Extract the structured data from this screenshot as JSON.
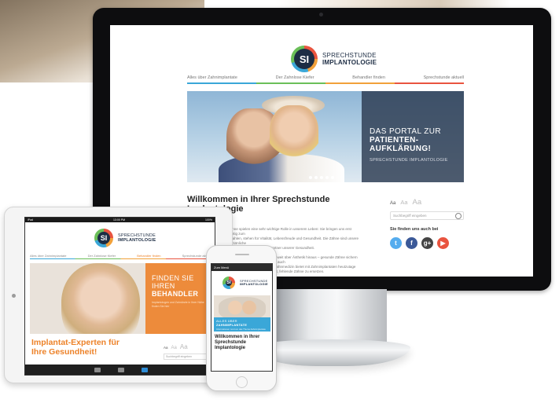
{
  "brand": {
    "mark": "SI",
    "line1": "SPRECHSTUNDE",
    "line2": "IMPLANTOLOGIE"
  },
  "colors": {
    "blue": "#3aa7d8",
    "green": "#6bbf59",
    "orange": "#ed8229",
    "red": "#e9543f",
    "navy": "#1d2d44"
  },
  "desktop": {
    "nav": [
      "Alles über Zahnimplantate",
      "Der Zahnlose Kiefer",
      "Behandler finden",
      "Sprechstunde aktuell"
    ],
    "hero": {
      "line1": "DAS PORTAL ZUR",
      "line2": "PATIENTEN-",
      "line3": "AUFKLÄRUNG!",
      "sub": "SPRECHSTUNDE IMPLANTOLOGIE"
    },
    "welcome": {
      "line1": "Willkommen in Ihrer Sprechstunde",
      "line2": "Implantologie"
    },
    "body": [
      "Zähne spielen eine sehr wichtige Rolle in unserem Leben: Sie bringen uns erst richtig zum",
      "Strahlen, stehen für Vitalität, Lebensfreude und Gesundheit. Die Zähne sind unsere persönliche",
      "Visitenkarte und ein fester Partner unserer Gesundheit.",
      "",
      "Doch die Zahngesundheit geht weit über Ästhetik hinaus – gesunde Zähne sichern nicht nur die Funktion, sondern auch",
      "Lebensqualität. Die moderne Zahnmedizin bietet mit Zahnimplantaten heutzutage",
      "eine hervorragende Möglichkeit, fehlende Zähne zu ersetzen."
    ],
    "sidebar": {
      "font_sizes": [
        "Aa",
        "Aa",
        "Aa"
      ],
      "search_placeholder": "Suchbegriff eingeben",
      "social_heading": "Sie finden uns auch bei",
      "social": [
        {
          "name": "twitter-icon",
          "glyph": "t",
          "color": "#55acee"
        },
        {
          "name": "facebook-icon",
          "glyph": "f",
          "color": "#3b5998"
        },
        {
          "name": "googleplus-icon",
          "glyph": "g+",
          "color": "#444444"
        },
        {
          "name": "youtube-icon",
          "glyph": "▶",
          "color": "#e9543f"
        }
      ]
    }
  },
  "tablet": {
    "status_left": "iPad",
    "status_center": "13:00 PM",
    "status_right": "100%",
    "nav": [
      "Alles über Zahnimplantate",
      "Der Zahnlose Kiefer",
      "Behandler finden",
      "Sprechstunde aktuell"
    ],
    "hero": {
      "line1": "FINDEN SIE",
      "line2": "IHREN",
      "line3": "BEHANDLER",
      "sub": "Implantologen und Zahnärzte in Ihrer Nähe finden Sie hier"
    },
    "title": "Implantat-Experten für Ihre Gesundheit!",
    "font_sizes": [
      "Aa",
      "Aa",
      "Aa"
    ],
    "search_placeholder": "Suchbegriff eingeben"
  },
  "phone": {
    "menu_label": "Zum Menü",
    "hero_line": "ALLES ÜBER",
    "hero_bold": "ZAHNIMPLANTATE",
    "hero_sub": "Informationen rund um das Thema Zahnimplantate",
    "title": "Willkommen in Ihrer Sprechstunde Implantologie"
  }
}
